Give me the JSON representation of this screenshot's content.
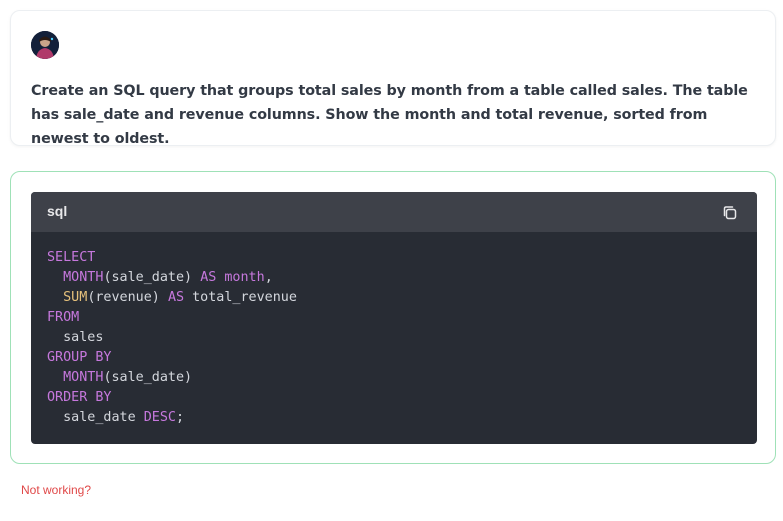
{
  "question": {
    "text": "Create an SQL query that groups total sales by month from a table called sales. The table has sale_date and revenue columns. Show the month and total revenue, sorted from newest to oldest."
  },
  "answer": {
    "code_language": "sql",
    "copy_icon": "copy-icon",
    "code_lines": [
      [
        {
          "t": "SELECT",
          "c": "kw"
        }
      ],
      [
        {
          "t": "  ",
          "c": "plain"
        },
        {
          "t": "MONTH",
          "c": "fn"
        },
        {
          "t": "(sale_date) ",
          "c": "plain"
        },
        {
          "t": "AS",
          "c": "kw"
        },
        {
          "t": " ",
          "c": "plain"
        },
        {
          "t": "month",
          "c": "kw"
        },
        {
          "t": ",",
          "c": "plain"
        }
      ],
      [
        {
          "t": "  ",
          "c": "plain"
        },
        {
          "t": "SUM",
          "c": "fn2"
        },
        {
          "t": "(revenue) ",
          "c": "plain"
        },
        {
          "t": "AS",
          "c": "kw"
        },
        {
          "t": " total_revenue",
          "c": "plain"
        }
      ],
      [
        {
          "t": "FROM",
          "c": "kw"
        }
      ],
      [
        {
          "t": "  sales",
          "c": "plain"
        }
      ],
      [
        {
          "t": "GROUP BY",
          "c": "kw"
        }
      ],
      [
        {
          "t": "  ",
          "c": "plain"
        },
        {
          "t": "MONTH",
          "c": "fn"
        },
        {
          "t": "(sale_date)",
          "c": "plain"
        }
      ],
      [
        {
          "t": "ORDER BY",
          "c": "kw"
        }
      ],
      [
        {
          "t": "  sale_date ",
          "c": "plain"
        },
        {
          "t": "DESC",
          "c": "kw"
        },
        {
          "t": ";",
          "c": "plain"
        }
      ]
    ]
  },
  "footer": {
    "not_working_label": "Not working?"
  },
  "colors": {
    "answer_border": "#9fe1b7",
    "code_background": "#282c34",
    "code_header": "#3e4149",
    "keyword": "#c678dd",
    "function_yellow": "#e5c07b",
    "link_red": "#e04848"
  }
}
